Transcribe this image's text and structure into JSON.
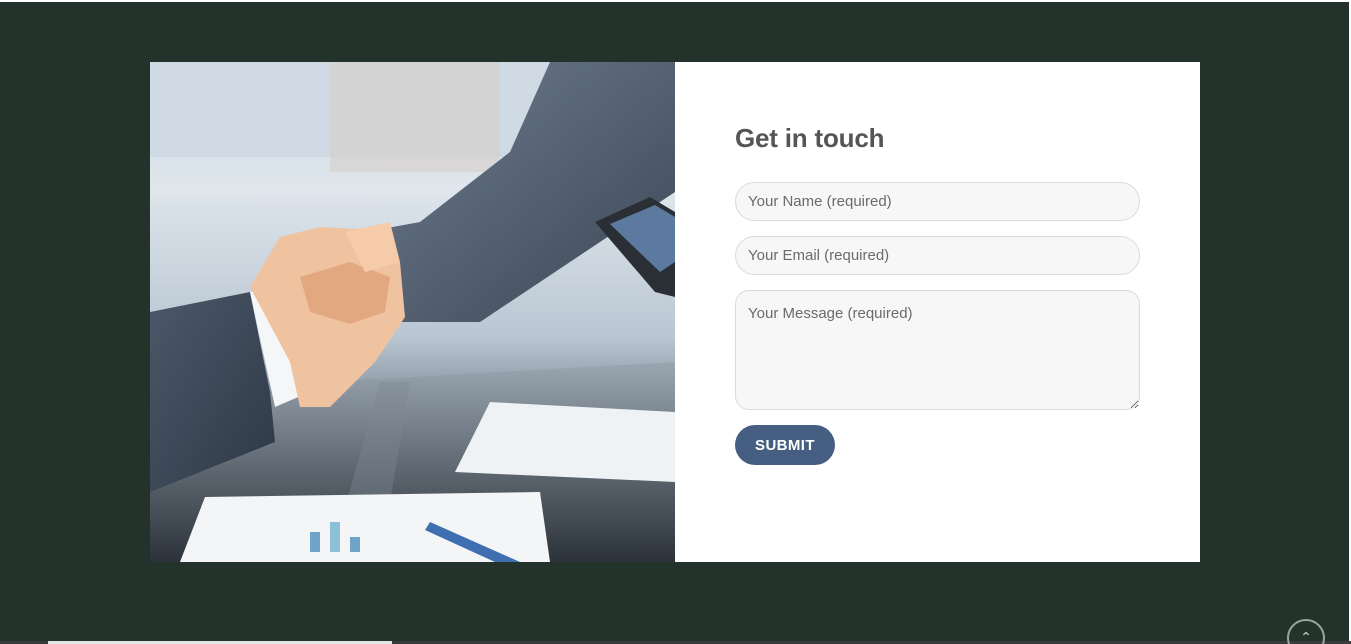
{
  "contact": {
    "title": "Get in touch",
    "name_placeholder": "Your Name (required)",
    "email_placeholder": "Your Email (required)",
    "message_placeholder": "Your Message (required)",
    "submit_label": "SUBMIT"
  },
  "photo": {
    "alt": "Business handshake photo"
  },
  "scroll_top": {
    "icon": "chevron-up-icon"
  },
  "colors": {
    "section_bg": "#23332b",
    "button": "#465e81",
    "title": "#555555"
  }
}
